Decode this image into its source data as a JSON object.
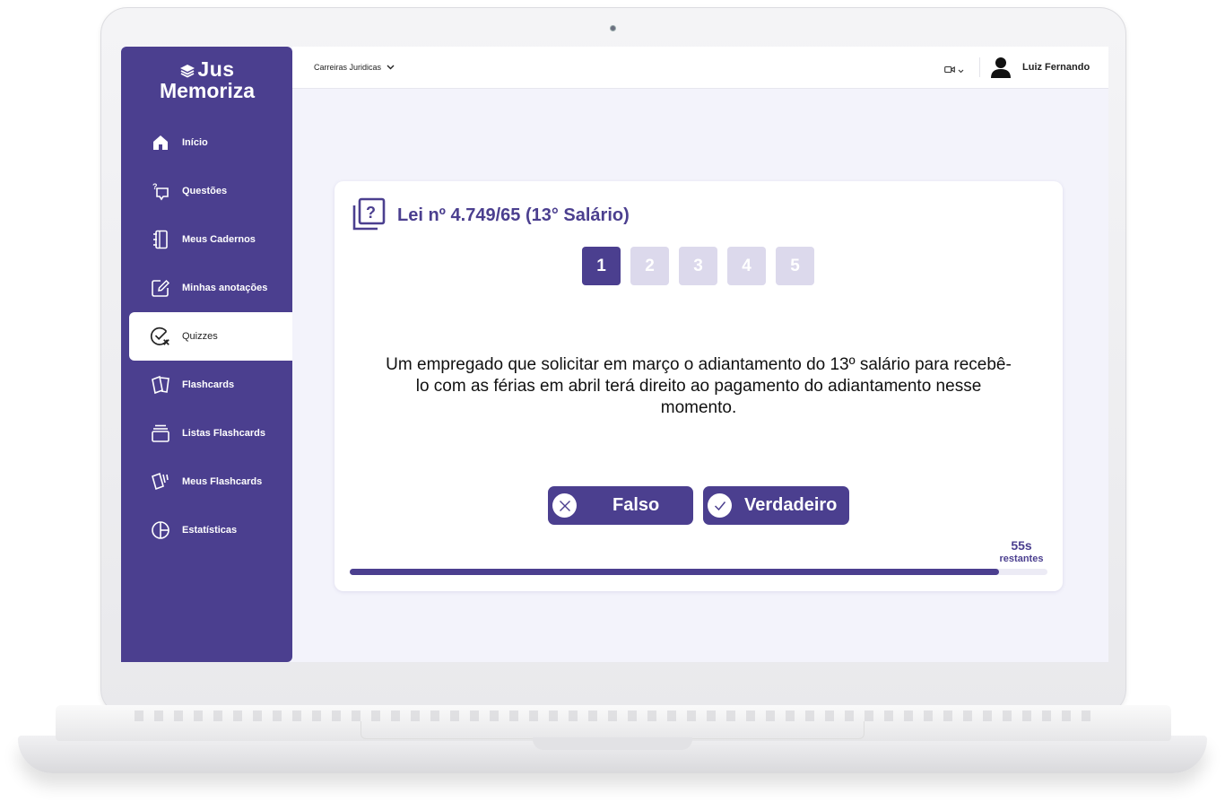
{
  "brand": {
    "line1": "Jus",
    "line2": "Memoriza"
  },
  "sidebar": {
    "items": [
      {
        "label": "Início",
        "icon": "home-icon"
      },
      {
        "label": "Questões",
        "icon": "question-bubble-icon"
      },
      {
        "label": "Meus Cadernos",
        "icon": "notebook-icon"
      },
      {
        "label": "Minhas anotações",
        "icon": "edit-note-icon"
      },
      {
        "label": "Quizzes",
        "icon": "quiz-check-icon",
        "active": true
      },
      {
        "label": "Flashcards",
        "icon": "flashcard-icon"
      },
      {
        "label": "Listas Flashcards",
        "icon": "stack-icon"
      },
      {
        "label": "Meus Flashcards",
        "icon": "cards-icon"
      },
      {
        "label": "Estatísticas",
        "icon": "pie-chart-icon"
      }
    ]
  },
  "topbar": {
    "career_label": "Carreiras Juridicas",
    "user_name": "Luiz Fernando"
  },
  "quiz": {
    "title": "Lei nº 4.749/65 (13° Salário)",
    "steps": [
      "1",
      "2",
      "3",
      "4",
      "5"
    ],
    "current_step": 1,
    "question": "Um empregado que solicitar em março o adiantamento do 13º salário para recebê-lo com as férias em abril terá direito ao pagamento do adiantamento nesse momento.",
    "false_label": "Falso",
    "true_label": "Verdadeiro",
    "timer_value": "55s",
    "timer_unit": "restantes",
    "progress_fraction": 0.93
  },
  "colors": {
    "primary": "#4b3f8f",
    "step_inactive": "#dcd9ec",
    "background": "#f3f3fb"
  }
}
